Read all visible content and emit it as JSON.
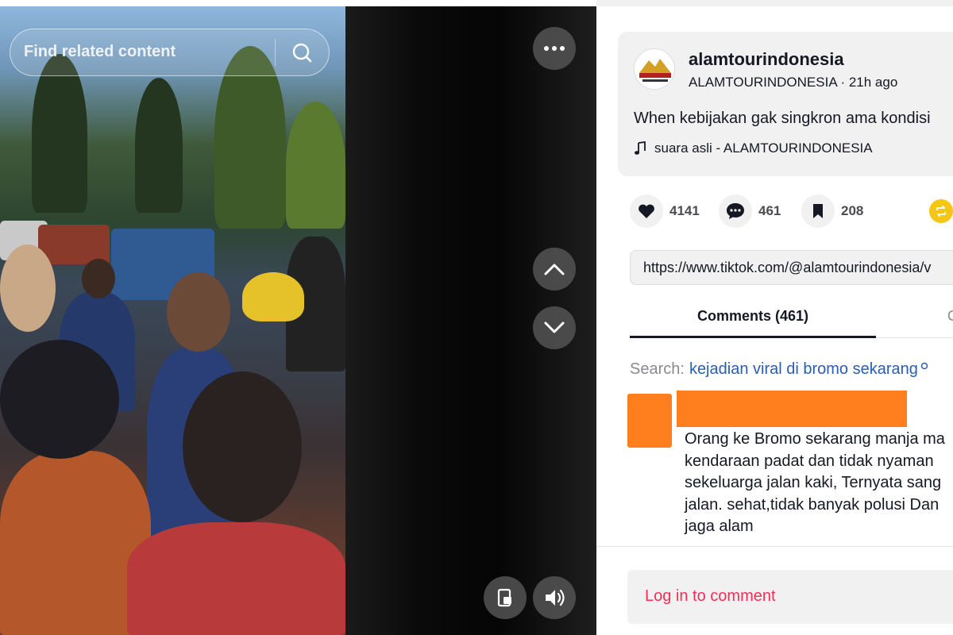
{
  "video": {
    "search_placeholder": "Find related content",
    "icons": {
      "search": "search-icon",
      "more": "more-horizontal-icon",
      "up": "chevron-up-icon",
      "down": "chevron-down-icon",
      "pip": "picture-in-picture-icon",
      "volume": "volume-icon"
    }
  },
  "post": {
    "author_name": "alamtourindonesia",
    "author_handle_time": "ALAMTOURINDONESIA · 21h ago",
    "caption": "When kebijakan gak singkron ama kondisi",
    "music": "suara asli - ALAMTOURINDONESIA"
  },
  "actions": {
    "likes": "4141",
    "comments": "461",
    "saves": "208"
  },
  "url": "https://www.tiktok.com/@alamtourindonesia/v",
  "tabs": {
    "comments_label": "Comments (461)",
    "second_label": "C"
  },
  "related": {
    "label": "Search:",
    "query": "kejadian viral di bromo sekarang"
  },
  "comment": {
    "lines": [
      "Orang ke Bromo sekarang manja ma",
      "kendaraan padat dan tidak nyaman",
      "sekeluarga jalan kaki, Ternyata sang",
      "jalan. sehat,tidak banyak polusi Dan",
      "jaga alam"
    ]
  },
  "login": {
    "label": "Log in to comment"
  },
  "colors": {
    "accent": "#fe2c55",
    "link": "#2b5db0",
    "redaction": "#ff7f1e",
    "share": "#f5c518"
  }
}
